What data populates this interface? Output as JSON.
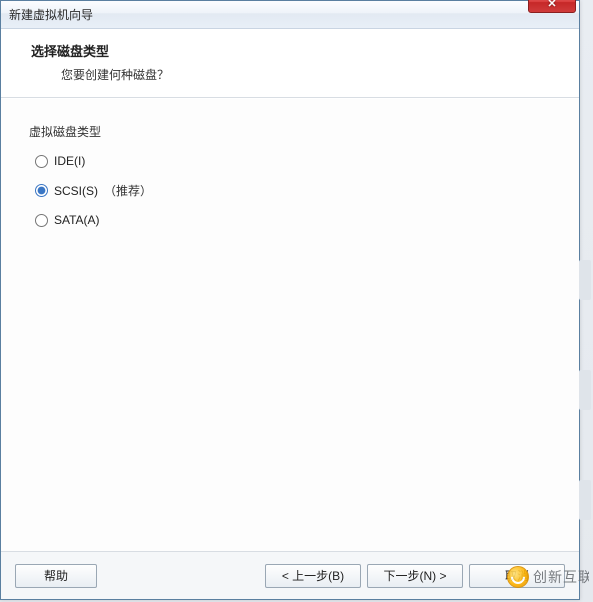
{
  "window": {
    "title": "新建虚拟机向导"
  },
  "header": {
    "heading": "选择磁盘类型",
    "subheading": "您要创建何种磁盘？"
  },
  "group": {
    "label": "虚拟磁盘类型",
    "options": [
      {
        "label": "IDE(I)",
        "selected": false,
        "hint": ""
      },
      {
        "label": "SCSI(S)",
        "selected": true,
        "hint": "（推荐）"
      },
      {
        "label": "SATA(A)",
        "selected": false,
        "hint": ""
      }
    ]
  },
  "footer": {
    "help": "帮助",
    "back": "< 上一步(B)",
    "next": "下一步(N) >",
    "cancel": "取消"
  },
  "watermark": {
    "text": "创新互联"
  }
}
